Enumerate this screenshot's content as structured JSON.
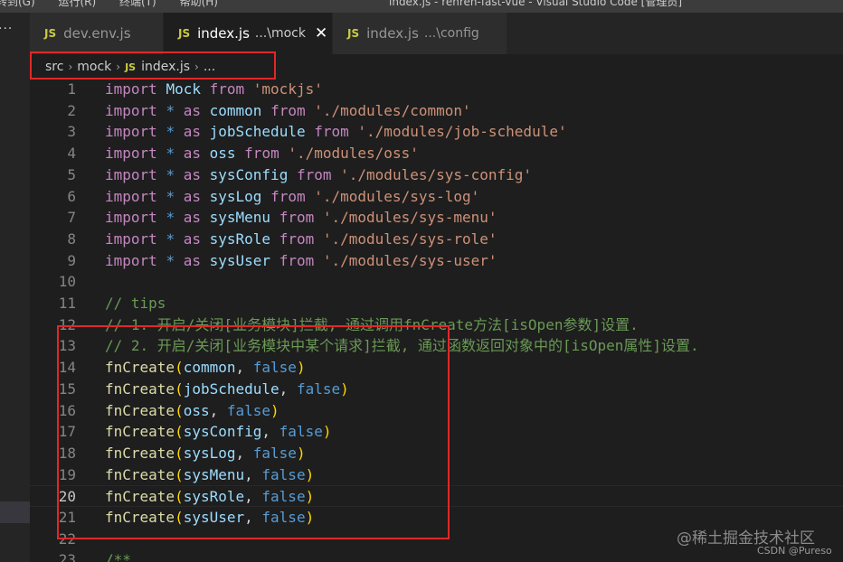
{
  "titlebar": {
    "menu": [
      "转到(G)",
      "运行(R)",
      "终端(T)",
      "帮助(H)"
    ],
    "title": "index.js - renren-fast-vue - Visual Studio Code [管理员]"
  },
  "sidebar": {
    "more_label": "···"
  },
  "tabs": [
    {
      "icon": "JS",
      "name": "dev.env.js",
      "desc": "",
      "active": false
    },
    {
      "icon": "JS",
      "name": "index.js",
      "desc": "...\\mock",
      "active": true,
      "close": "✕"
    },
    {
      "icon": "JS",
      "name": "index.js",
      "desc": "...\\config",
      "active": false
    }
  ],
  "breadcrumb": {
    "folder1": "src",
    "folder2": "mock",
    "file_icon": "JS",
    "file": "index.js",
    "more": "...",
    "separator": "›"
  },
  "editor": {
    "current_line": 20,
    "lines": [
      {
        "n": "1",
        "tokens": [
          [
            "kw",
            "import"
          ],
          [
            "plain",
            " "
          ],
          [
            "id",
            "Mock"
          ],
          [
            "plain",
            " "
          ],
          [
            "kw",
            "from"
          ],
          [
            "plain",
            " "
          ],
          [
            "str",
            "'mockjs'"
          ]
        ]
      },
      {
        "n": "2",
        "tokens": [
          [
            "kw",
            "import"
          ],
          [
            "plain",
            " "
          ],
          [
            "bool",
            "*"
          ],
          [
            "plain",
            " "
          ],
          [
            "kw",
            "as"
          ],
          [
            "plain",
            " "
          ],
          [
            "id",
            "common"
          ],
          [
            "plain",
            " "
          ],
          [
            "kw",
            "from"
          ],
          [
            "plain",
            " "
          ],
          [
            "str",
            "'./modules/common'"
          ]
        ]
      },
      {
        "n": "3",
        "tokens": [
          [
            "kw",
            "import"
          ],
          [
            "plain",
            " "
          ],
          [
            "bool",
            "*"
          ],
          [
            "plain",
            " "
          ],
          [
            "kw",
            "as"
          ],
          [
            "plain",
            " "
          ],
          [
            "id",
            "jobSchedule"
          ],
          [
            "plain",
            " "
          ],
          [
            "kw",
            "from"
          ],
          [
            "plain",
            " "
          ],
          [
            "str",
            "'./modules/job-schedule'"
          ]
        ]
      },
      {
        "n": "4",
        "tokens": [
          [
            "kw",
            "import"
          ],
          [
            "plain",
            " "
          ],
          [
            "bool",
            "*"
          ],
          [
            "plain",
            " "
          ],
          [
            "kw",
            "as"
          ],
          [
            "plain",
            " "
          ],
          [
            "id",
            "oss"
          ],
          [
            "plain",
            " "
          ],
          [
            "kw",
            "from"
          ],
          [
            "plain",
            " "
          ],
          [
            "str",
            "'./modules/oss'"
          ]
        ]
      },
      {
        "n": "5",
        "tokens": [
          [
            "kw",
            "import"
          ],
          [
            "plain",
            " "
          ],
          [
            "bool",
            "*"
          ],
          [
            "plain",
            " "
          ],
          [
            "kw",
            "as"
          ],
          [
            "plain",
            " "
          ],
          [
            "id",
            "sysConfig"
          ],
          [
            "plain",
            " "
          ],
          [
            "kw",
            "from"
          ],
          [
            "plain",
            " "
          ],
          [
            "str",
            "'./modules/sys-config'"
          ]
        ]
      },
      {
        "n": "6",
        "tokens": [
          [
            "kw",
            "import"
          ],
          [
            "plain",
            " "
          ],
          [
            "bool",
            "*"
          ],
          [
            "plain",
            " "
          ],
          [
            "kw",
            "as"
          ],
          [
            "plain",
            " "
          ],
          [
            "id",
            "sysLog"
          ],
          [
            "plain",
            " "
          ],
          [
            "kw",
            "from"
          ],
          [
            "plain",
            " "
          ],
          [
            "str",
            "'./modules/sys-log'"
          ]
        ]
      },
      {
        "n": "7",
        "tokens": [
          [
            "kw",
            "import"
          ],
          [
            "plain",
            " "
          ],
          [
            "bool",
            "*"
          ],
          [
            "plain",
            " "
          ],
          [
            "kw",
            "as"
          ],
          [
            "plain",
            " "
          ],
          [
            "id",
            "sysMenu"
          ],
          [
            "plain",
            " "
          ],
          [
            "kw",
            "from"
          ],
          [
            "plain",
            " "
          ],
          [
            "str",
            "'./modules/sys-menu'"
          ]
        ]
      },
      {
        "n": "8",
        "tokens": [
          [
            "kw",
            "import"
          ],
          [
            "plain",
            " "
          ],
          [
            "bool",
            "*"
          ],
          [
            "plain",
            " "
          ],
          [
            "kw",
            "as"
          ],
          [
            "plain",
            " "
          ],
          [
            "id",
            "sysRole"
          ],
          [
            "plain",
            " "
          ],
          [
            "kw",
            "from"
          ],
          [
            "plain",
            " "
          ],
          [
            "str",
            "'./modules/sys-role'"
          ]
        ]
      },
      {
        "n": "9",
        "tokens": [
          [
            "kw",
            "import"
          ],
          [
            "plain",
            " "
          ],
          [
            "bool",
            "*"
          ],
          [
            "plain",
            " "
          ],
          [
            "kw",
            "as"
          ],
          [
            "plain",
            " "
          ],
          [
            "id",
            "sysUser"
          ],
          [
            "plain",
            " "
          ],
          [
            "kw",
            "from"
          ],
          [
            "plain",
            " "
          ],
          [
            "str",
            "'./modules/sys-user'"
          ]
        ]
      },
      {
        "n": "10",
        "tokens": []
      },
      {
        "n": "11",
        "tokens": [
          [
            "cmt",
            "// tips"
          ]
        ]
      },
      {
        "n": "12",
        "tokens": [
          [
            "cmt",
            "// 1. 开启/关闭[业务模块]拦截, 通过调用fnCreate方法[isOpen参数]设置."
          ]
        ]
      },
      {
        "n": "13",
        "tokens": [
          [
            "cmt",
            "// 2. 开启/关闭[业务模块中某个请求]拦截, 通过函数返回对象中的[isOpen属性]设置."
          ]
        ]
      },
      {
        "n": "14",
        "tokens": [
          [
            "fn",
            "fnCreate"
          ],
          [
            "paren",
            "("
          ],
          [
            "id",
            "common"
          ],
          [
            "punc",
            ", "
          ],
          [
            "bool",
            "false"
          ],
          [
            "paren",
            ")"
          ]
        ]
      },
      {
        "n": "15",
        "tokens": [
          [
            "fn",
            "fnCreate"
          ],
          [
            "paren",
            "("
          ],
          [
            "id",
            "jobSchedule"
          ],
          [
            "punc",
            ", "
          ],
          [
            "bool",
            "false"
          ],
          [
            "paren",
            ")"
          ]
        ]
      },
      {
        "n": "16",
        "tokens": [
          [
            "fn",
            "fnCreate"
          ],
          [
            "paren",
            "("
          ],
          [
            "id",
            "oss"
          ],
          [
            "punc",
            ", "
          ],
          [
            "bool",
            "false"
          ],
          [
            "paren",
            ")"
          ]
        ]
      },
      {
        "n": "17",
        "tokens": [
          [
            "fn",
            "fnCreate"
          ],
          [
            "paren",
            "("
          ],
          [
            "id",
            "sysConfig"
          ],
          [
            "punc",
            ", "
          ],
          [
            "bool",
            "false"
          ],
          [
            "paren",
            ")"
          ]
        ]
      },
      {
        "n": "18",
        "tokens": [
          [
            "fn",
            "fnCreate"
          ],
          [
            "paren",
            "("
          ],
          [
            "id",
            "sysLog"
          ],
          [
            "punc",
            ", "
          ],
          [
            "bool",
            "false"
          ],
          [
            "paren",
            ")"
          ]
        ]
      },
      {
        "n": "19",
        "tokens": [
          [
            "fn",
            "fnCreate"
          ],
          [
            "paren",
            "("
          ],
          [
            "id",
            "sysMenu"
          ],
          [
            "punc",
            ", "
          ],
          [
            "bool",
            "false"
          ],
          [
            "paren",
            ")"
          ]
        ]
      },
      {
        "n": "20",
        "tokens": [
          [
            "fn",
            "fnCreate"
          ],
          [
            "paren",
            "("
          ],
          [
            "id",
            "sysRole"
          ],
          [
            "punc",
            ", "
          ],
          [
            "bool",
            "false"
          ],
          [
            "paren",
            ")"
          ]
        ]
      },
      {
        "n": "21",
        "tokens": [
          [
            "fn",
            "fnCreate"
          ],
          [
            "paren",
            "("
          ],
          [
            "id",
            "sysUser"
          ],
          [
            "punc",
            ", "
          ],
          [
            "bool",
            "false"
          ],
          [
            "paren",
            ")"
          ]
        ]
      },
      {
        "n": "22",
        "tokens": []
      },
      {
        "n": "23",
        "tokens": [
          [
            "cmt",
            "/**"
          ]
        ]
      }
    ]
  },
  "watermark": {
    "site": "@稀土掘金技术社区",
    "author": "CSDN @Pureso"
  },
  "colors": {
    "highlight_box": "#e02828",
    "editor_bg": "#1e1e1e",
    "js_icon": "#cbcb41"
  }
}
